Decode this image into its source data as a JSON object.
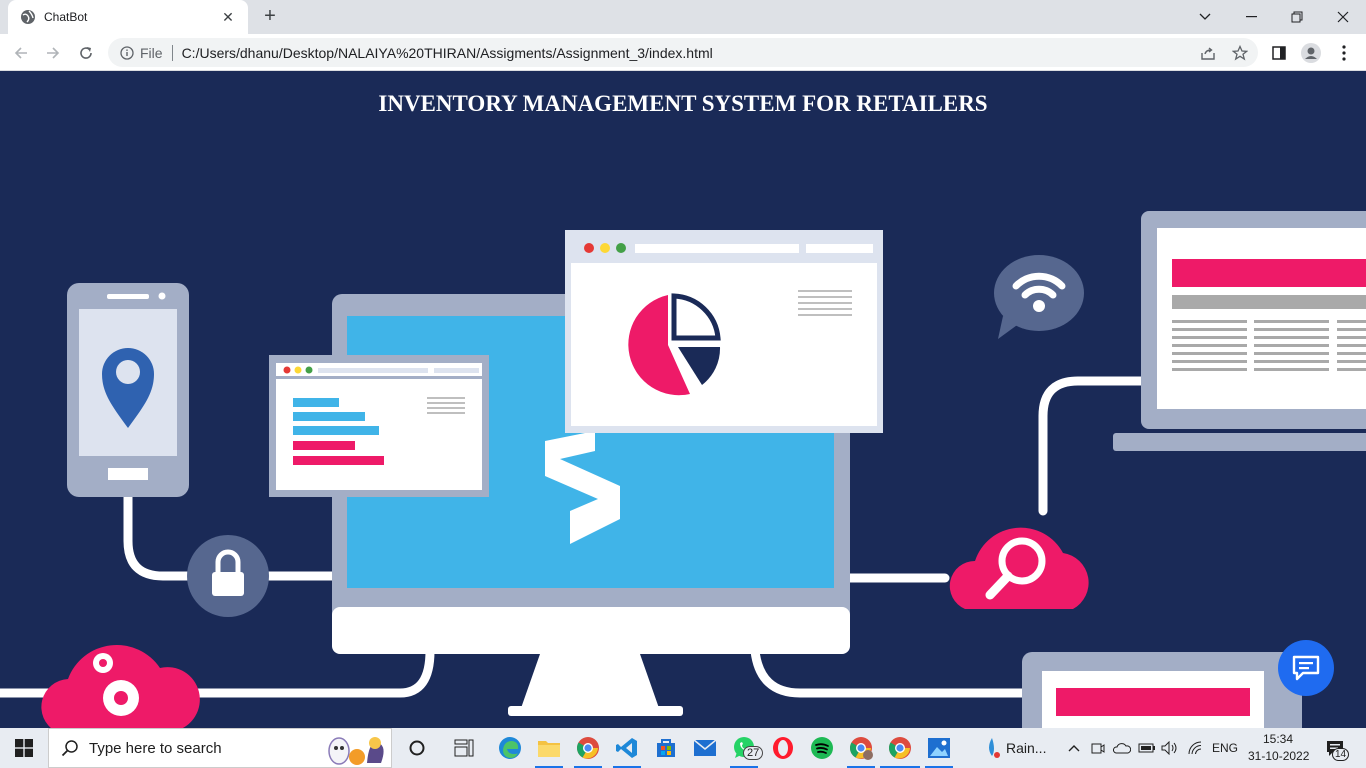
{
  "browser": {
    "tab_title": "ChatBot",
    "address_scheme": "File",
    "address_url": "C:/Users/dhanu/Desktop/NALAIYA%20THIRAN/Assigments/Assignment_3/index.html"
  },
  "page": {
    "title": "INVENTORY MANAGEMENT SYSTEM FOR RETAILERS"
  },
  "taskbar": {
    "search_placeholder": "Type here to search",
    "whatsapp_badge": "27",
    "running_app_label": "Rain...",
    "language": "ENG",
    "time": "15:34",
    "date": "31-10-2022",
    "notifications_count": "14"
  },
  "colors": {
    "page_bg": "#1a2a57",
    "accent_pink": "#ee1a68",
    "accent_blue": "#40b4e8",
    "device_grey": "#a3aec6",
    "chat_fab": "#1f6bf0"
  },
  "icons": [
    "globe-icon",
    "close-icon",
    "plus-icon",
    "chevron-down-icon",
    "minimize-icon",
    "restore-icon",
    "back-icon",
    "forward-icon",
    "reload-icon",
    "info-icon",
    "share-icon",
    "star-icon",
    "side-panel-icon",
    "profile-icon",
    "menu-icon",
    "chat-icon",
    "windows-icon",
    "search-icon"
  ]
}
